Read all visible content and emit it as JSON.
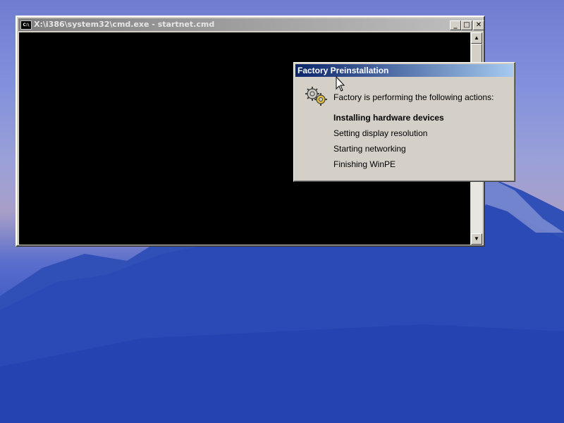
{
  "cmd_window": {
    "title": "X:\\i386\\system32\\cmd.exe - startnet.cmd",
    "icon_label": "C:\\"
  },
  "dialog": {
    "title": "Factory Preinstallation",
    "intro": "Factory is performing the following actions:",
    "actions": [
      {
        "label": "Installing hardware devices",
        "active": true
      },
      {
        "label": "Setting display resolution",
        "active": false
      },
      {
        "label": "Starting networking",
        "active": false
      },
      {
        "label": "Finishing WinPE",
        "active": false
      }
    ]
  },
  "colors": {
    "title_active_start": "#0a246a",
    "title_active_end": "#a6caf0",
    "title_inactive": "#808080",
    "console_bg": "#000000",
    "window_face": "#d4d0c8"
  }
}
